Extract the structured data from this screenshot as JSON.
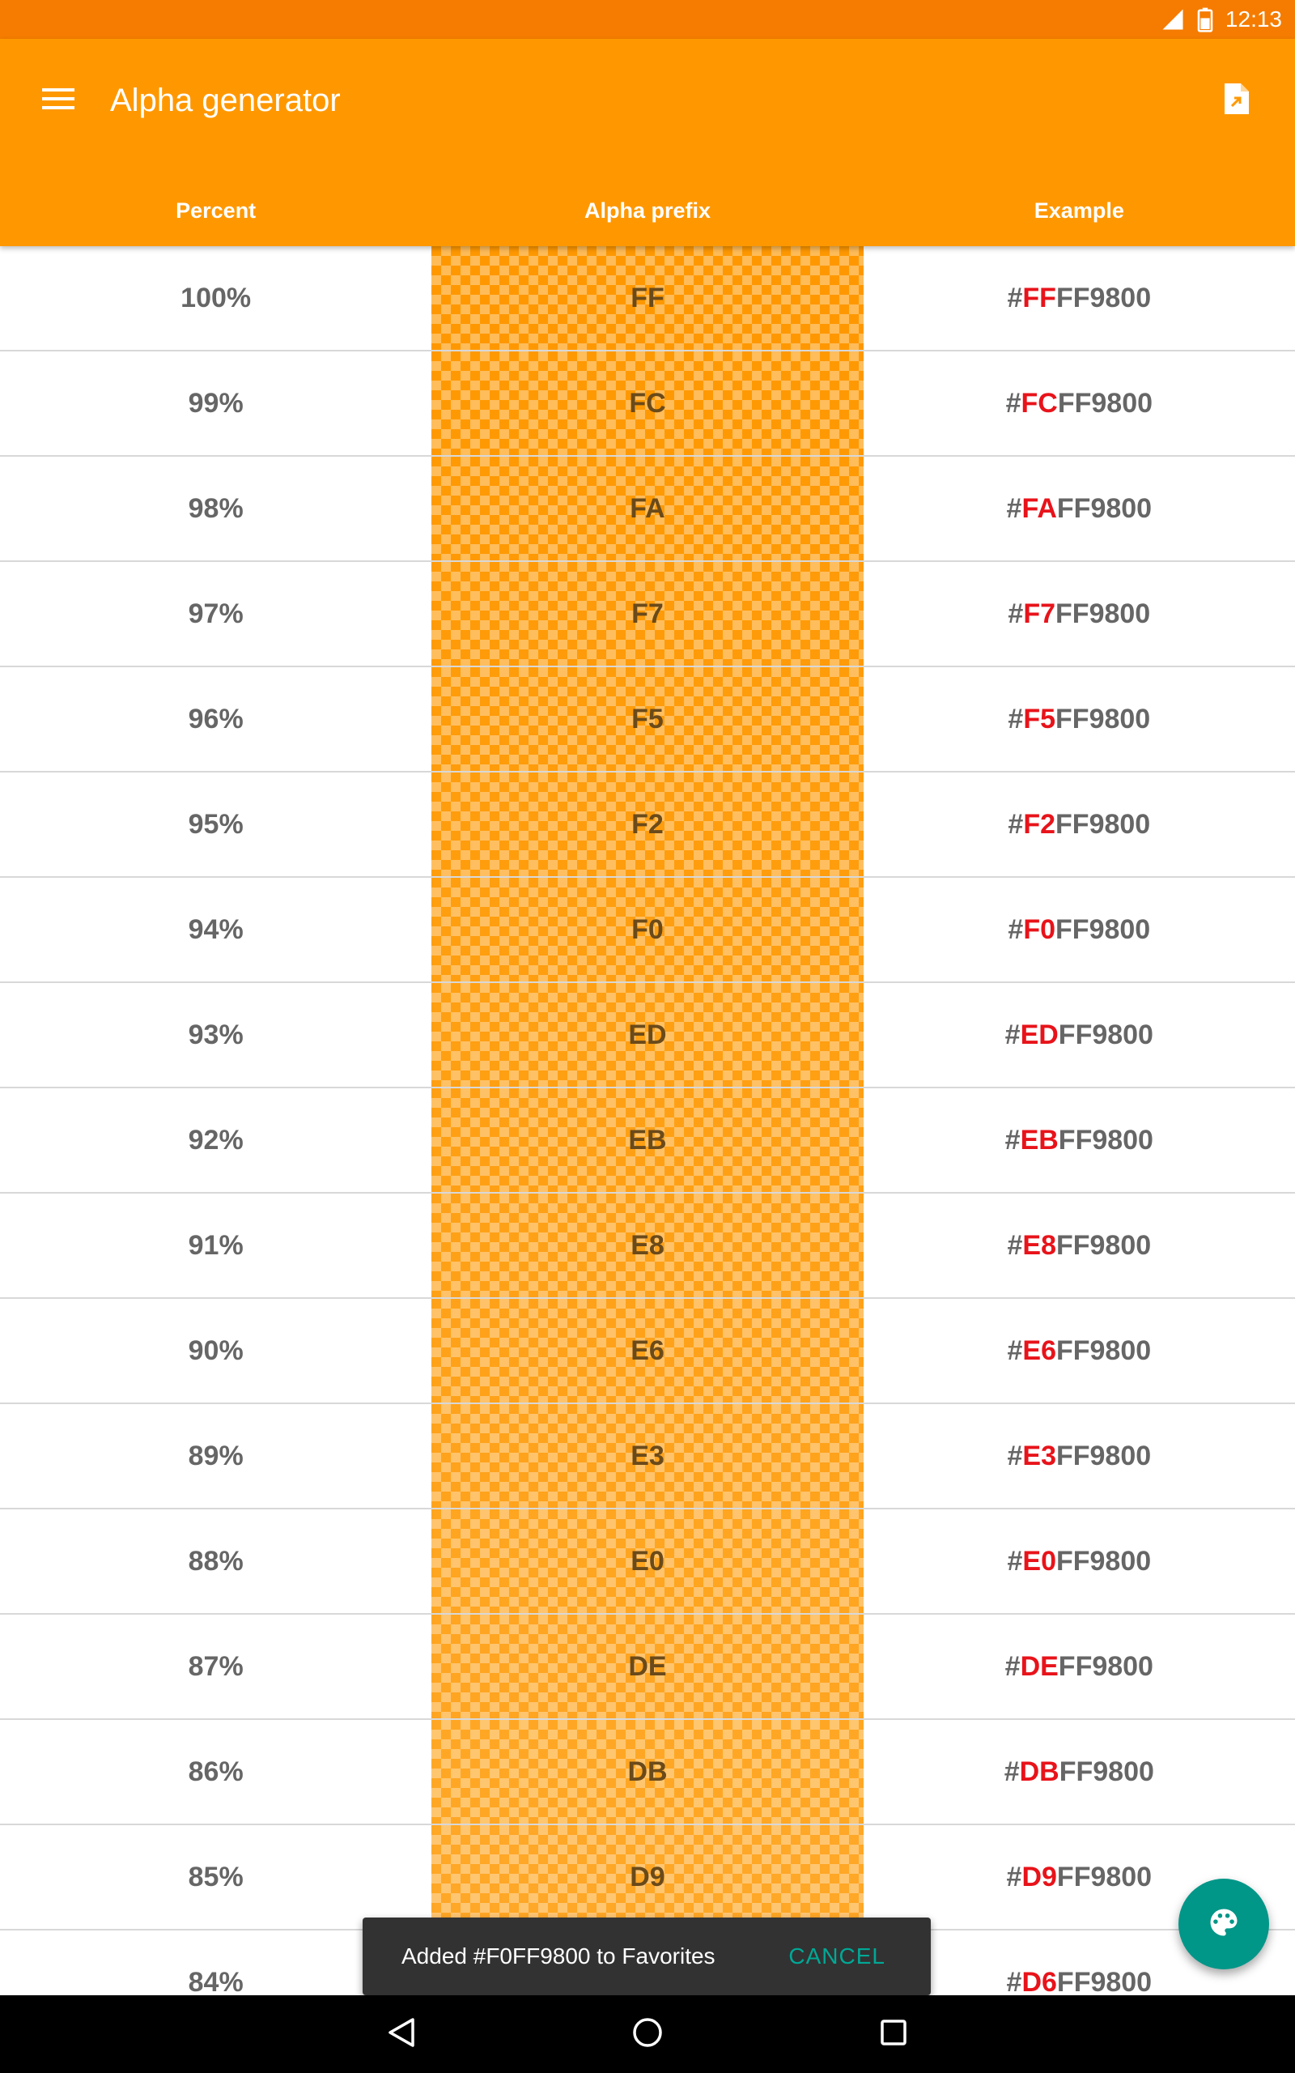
{
  "status_bar": {
    "time": "12:13"
  },
  "app_bar": {
    "title": "Alpha generator"
  },
  "table": {
    "headers": [
      "Percent",
      "Alpha prefix",
      "Example"
    ],
    "base_color": "FF9800",
    "rows": [
      {
        "percent": "100%",
        "alpha": "FF",
        "hash": "#",
        "rest": "FF9800"
      },
      {
        "percent": "99%",
        "alpha": "FC",
        "hash": "#",
        "rest": "FF9800"
      },
      {
        "percent": "98%",
        "alpha": "FA",
        "hash": "#",
        "rest": "FF9800"
      },
      {
        "percent": "97%",
        "alpha": "F7",
        "hash": "#",
        "rest": "FF9800"
      },
      {
        "percent": "96%",
        "alpha": "F5",
        "hash": "#",
        "rest": "FF9800"
      },
      {
        "percent": "95%",
        "alpha": "F2",
        "hash": "#",
        "rest": "FF9800"
      },
      {
        "percent": "94%",
        "alpha": "F0",
        "hash": "#",
        "rest": "FF9800"
      },
      {
        "percent": "93%",
        "alpha": "ED",
        "hash": "#",
        "rest": "FF9800"
      },
      {
        "percent": "92%",
        "alpha": "EB",
        "hash": "#",
        "rest": "FF9800"
      },
      {
        "percent": "91%",
        "alpha": "E8",
        "hash": "#",
        "rest": "FF9800"
      },
      {
        "percent": "90%",
        "alpha": "E6",
        "hash": "#",
        "rest": "FF9800"
      },
      {
        "percent": "89%",
        "alpha": "E3",
        "hash": "#",
        "rest": "FF9800"
      },
      {
        "percent": "88%",
        "alpha": "E0",
        "hash": "#",
        "rest": "FF9800"
      },
      {
        "percent": "87%",
        "alpha": "DE",
        "hash": "#",
        "rest": "FF9800"
      },
      {
        "percent": "86%",
        "alpha": "DB",
        "hash": "#",
        "rest": "FF9800"
      },
      {
        "percent": "85%",
        "alpha": "D9",
        "hash": "#",
        "rest": "FF9800"
      },
      {
        "percent": "84%",
        "alpha": "D6",
        "hash": "#",
        "rest": "FF9800"
      }
    ]
  },
  "snackbar": {
    "message": "Added #F0FF9800 to Favorites",
    "action": "CANCEL"
  },
  "colors": {
    "primary": "#FF9800",
    "primary_dark": "#F57C00",
    "accent": "#009688",
    "alpha_highlight": "#E8131A",
    "snackbar_action": "#00A896"
  },
  "icons": {
    "menu": "menu-icon",
    "export": "export-file-icon",
    "fab": "palette-icon",
    "nav_back": "back-triangle-icon",
    "nav_home": "home-circle-icon",
    "nav_recents": "recents-square-icon",
    "signal": "signal-icon",
    "battery": "battery-icon"
  }
}
